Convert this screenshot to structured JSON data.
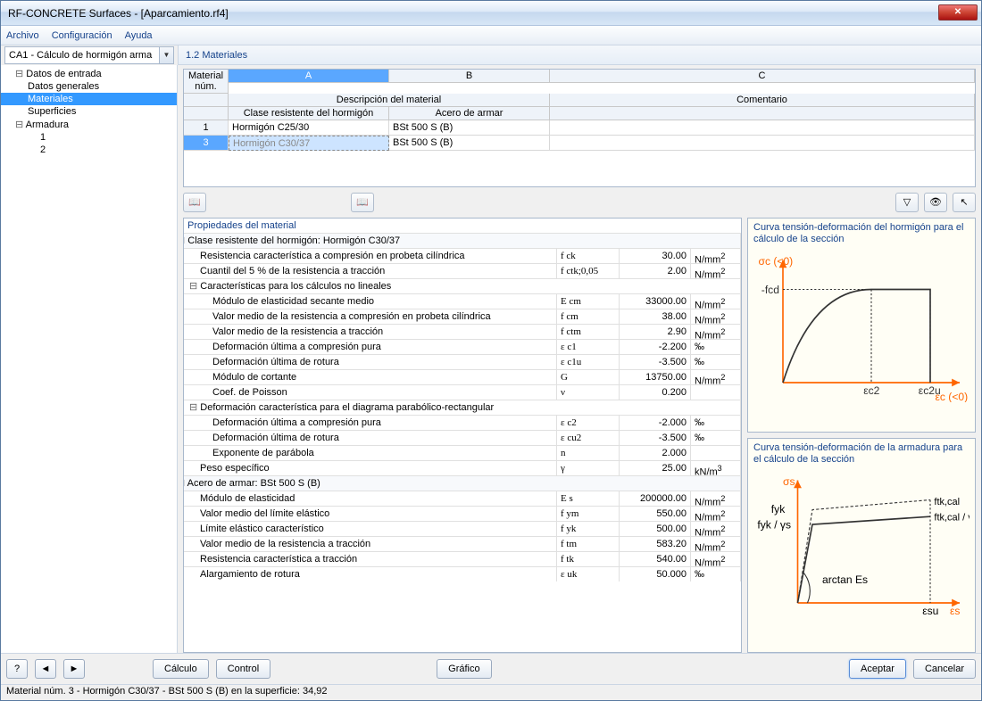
{
  "window": {
    "title": "RF-CONCRETE Surfaces - [Aparcamiento.rf4]"
  },
  "menu": {
    "file": "Archivo",
    "config": "Configuración",
    "help": "Ayuda"
  },
  "combo": {
    "text": "CA1 - Cálculo de hormigón arma"
  },
  "section_title": "1.2 Materiales",
  "tree": {
    "root1": "Datos de entrada",
    "g1": "Datos generales",
    "g2": "Materiales",
    "g3": "Superficies",
    "root2": "Armadura",
    "a1": "1",
    "a2": "2"
  },
  "grid": {
    "header_material_num": "Material\nnúm.",
    "header_desc": "Descripción del material",
    "header_A": "A",
    "header_B": "B",
    "header_C": "C",
    "header_classC": "Clase resistente del hormigón",
    "header_steel": "Acero de armar",
    "header_comment": "Comentario",
    "rows": [
      {
        "num": "1",
        "conc": "Hormigón C25/30",
        "steel": "BSt 500 S (B)",
        "comment": ""
      },
      {
        "num": "3",
        "conc": "Hormigón C30/37",
        "steel": "BSt 500 S (B)",
        "comment": ""
      }
    ]
  },
  "props_title": "Propiedades del material",
  "props": [
    {
      "lvl": 0,
      "out": true,
      "label": "Clase resistente del hormigón: Hormigón C30/37",
      "sym": "",
      "val": "",
      "unit": ""
    },
    {
      "lvl": 1,
      "label": "Resistencia característica a compresión en probeta cilíndrica",
      "sym": "f ck",
      "val": "30.00",
      "unit": "N/mm²"
    },
    {
      "lvl": 1,
      "label": "Cuantil del 5 % de la resistencia a tracción",
      "sym": "f ctk;0,05",
      "val": "2.00",
      "unit": "N/mm²"
    },
    {
      "lvl": 1,
      "out": true,
      "label": "Características para los cálculos no lineales",
      "sym": "",
      "val": "",
      "unit": ""
    },
    {
      "lvl": 2,
      "label": "Módulo de elasticidad secante medio",
      "sym": "E cm",
      "val": "33000.00",
      "unit": "N/mm²"
    },
    {
      "lvl": 2,
      "label": "Valor medio de la resistencia a compresión en probeta cilíndrica",
      "sym": "f cm",
      "val": "38.00",
      "unit": "N/mm²"
    },
    {
      "lvl": 2,
      "label": "Valor medio de la resistencia a tracción",
      "sym": "f ctm",
      "val": "2.90",
      "unit": "N/mm²"
    },
    {
      "lvl": 2,
      "label": "Deformación última a compresión pura",
      "sym": "ε c1",
      "val": "-2.200",
      "unit": "‰"
    },
    {
      "lvl": 2,
      "label": "Deformación última de rotura",
      "sym": "ε c1u",
      "val": "-3.500",
      "unit": "‰"
    },
    {
      "lvl": 2,
      "label": "Módulo de cortante",
      "sym": "G",
      "val": "13750.00",
      "unit": "N/mm²"
    },
    {
      "lvl": 2,
      "label": "Coef. de Poisson",
      "sym": "ν",
      "val": "0.200",
      "unit": ""
    },
    {
      "lvl": 1,
      "out": true,
      "label": "Deformación característica para el diagrama parabólico-rectangular",
      "sym": "",
      "val": "",
      "unit": ""
    },
    {
      "lvl": 2,
      "label": "Deformación última a compresión pura",
      "sym": "ε c2",
      "val": "-2.000",
      "unit": "‰"
    },
    {
      "lvl": 2,
      "label": "Deformación última de rotura",
      "sym": "ε cu2",
      "val": "-3.500",
      "unit": "‰"
    },
    {
      "lvl": 2,
      "label": "Exponente de parábola",
      "sym": "n",
      "val": "2.000",
      "unit": ""
    },
    {
      "lvl": 1,
      "label": "Peso específico",
      "sym": "γ",
      "val": "25.00",
      "unit": "kN/m³"
    },
    {
      "lvl": 0,
      "out": true,
      "label": "Acero de armar: BSt 500 S (B)",
      "sym": "",
      "val": "",
      "unit": ""
    },
    {
      "lvl": 1,
      "label": "Módulo de elasticidad",
      "sym": "E s",
      "val": "200000.00",
      "unit": "N/mm²"
    },
    {
      "lvl": 1,
      "label": "Valor medio del límite elástico",
      "sym": "f ym",
      "val": "550.00",
      "unit": "N/mm²"
    },
    {
      "lvl": 1,
      "label": "Límite elástico característico",
      "sym": "f yk",
      "val": "500.00",
      "unit": "N/mm²"
    },
    {
      "lvl": 1,
      "label": "Valor medio de la resistencia a tracción",
      "sym": "f tm",
      "val": "583.20",
      "unit": "N/mm²"
    },
    {
      "lvl": 1,
      "label": "Resistencia característica a tracción",
      "sym": "f tk",
      "val": "540.00",
      "unit": "N/mm²"
    },
    {
      "lvl": 1,
      "label": "Alargamiento de rotura",
      "sym": "ε uk",
      "val": "50.000",
      "unit": "‰"
    }
  ],
  "graph1": {
    "title": "Curva tensión-deformación del hormigón para el cálculo de la sección",
    "ylabel": "σc (<0)",
    "y_fcd": "-fcd",
    "x_ec2": "εc2",
    "x_ec2u": "εc2u",
    "xlabel": "εc (<0)"
  },
  "graph2": {
    "title": "Curva tensión-deformación de la armadura para el cálculo de la sección",
    "ylabel": "σs",
    "fyk": "fyk",
    "fykg": "fyk / γs",
    "ftkcal": "ftk,cal",
    "ftkcalg": "ftk,cal / γs",
    "arctan": "arctan Es",
    "esu": "εsu",
    "xlabel": "εs"
  },
  "buttons": {
    "calc": "Cálculo",
    "control": "Control",
    "graph": "Gráfico",
    "ok": "Aceptar",
    "cancel": "Cancelar"
  },
  "status": "Material núm. 3  -  Hormigón C30/37 - BSt 500 S (B) en la superficie: 34,92"
}
